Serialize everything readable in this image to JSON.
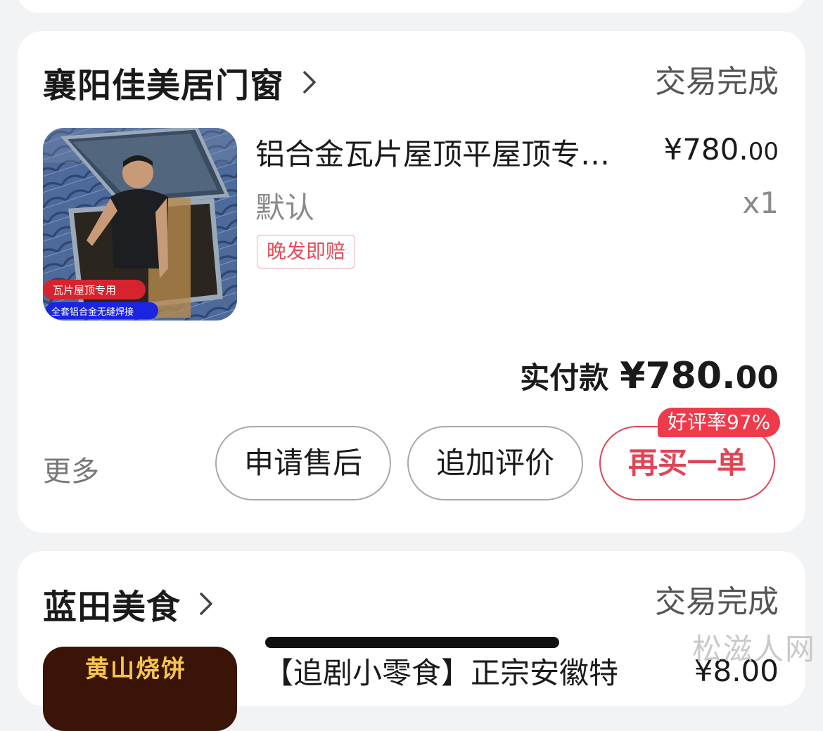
{
  "orders": [
    {
      "shop_name": "襄阳佳美居门窗",
      "status": "交易完成",
      "product": {
        "name": "铝合金瓦片屋顶平屋顶专用天窗",
        "image_captions": [
          "瓦片屋顶专用",
          "全套铝合金无缝焊接"
        ],
        "spec": "默认",
        "price_int": "¥780.",
        "price_dec": "00",
        "qty": "x1",
        "tag": "晚发即赔"
      },
      "total_label": "实付款",
      "total_int": "¥780.",
      "total_dec": "00",
      "more_label": "更多",
      "buttons": {
        "after_sale": "申请售后",
        "add_review": "追加评价",
        "rebuy": "再买一单"
      },
      "rebuy_badge": "好评率97%"
    },
    {
      "shop_name": "蓝田美食",
      "status": "交易完成",
      "product": {
        "name": "【追剧小零食】正宗安徽特",
        "image_caption": "黄山烧饼",
        "price_int": "¥8.",
        "price_dec": "00"
      }
    }
  ],
  "watermark": "松滋人网",
  "colors": {
    "accent": "#e04556",
    "badge": "#ee3a4a",
    "background": "#f2f3f5"
  }
}
